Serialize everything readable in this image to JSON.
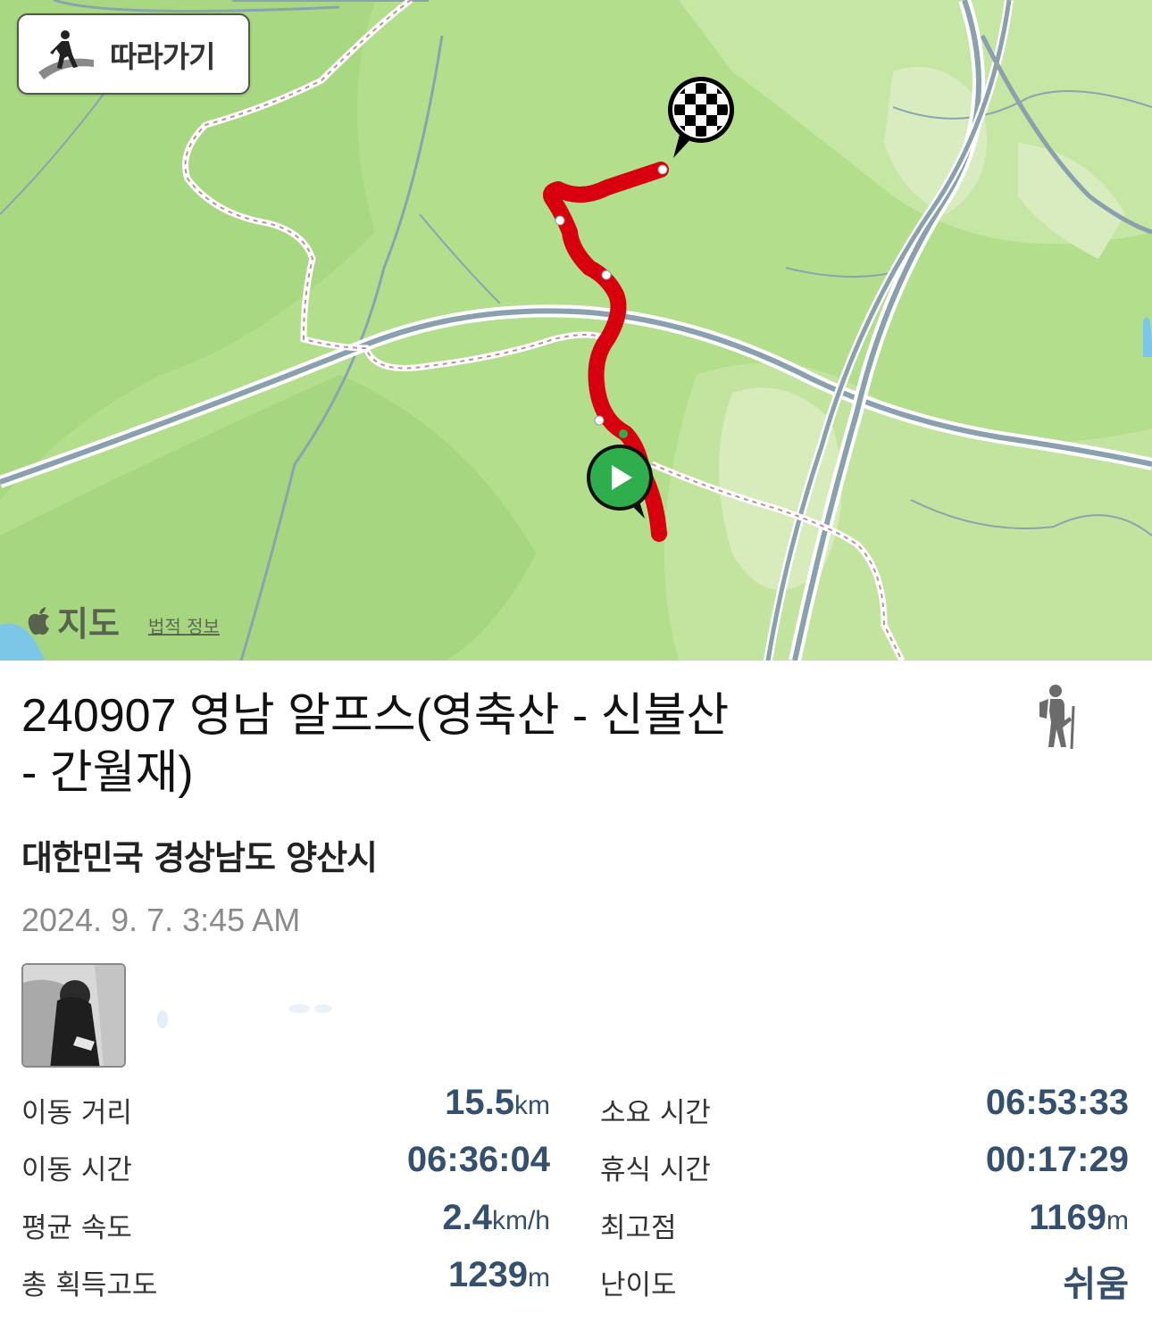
{
  "map": {
    "follow_button_label": "따라가기",
    "attribution_brand": "지도",
    "legal_link": "법적 정보",
    "colors": {
      "land": "#b6e08f",
      "route": "#d8000e",
      "start_marker": "#2fae4e"
    }
  },
  "activity": {
    "title_line1": "240907 영남 알프스(영축산 - 신불산",
    "title_line2": "- 간월재)",
    "location": "대한민국 경상남도 양산시",
    "datetime": "2024. 9. 7. 3:45 AM",
    "type_icon": "hiker-icon"
  },
  "stats": {
    "distance": {
      "label": "이동 거리",
      "value": "15.5",
      "unit": "km"
    },
    "total_time": {
      "label": "소요 시간",
      "value": "06:53:33",
      "unit": ""
    },
    "moving_time": {
      "label": "이동 시간",
      "value": "06:36:04",
      "unit": ""
    },
    "rest_time": {
      "label": "휴식 시간",
      "value": "00:17:29",
      "unit": ""
    },
    "avg_speed": {
      "label": "평균 속도",
      "value": "2.4",
      "unit": "km/h"
    },
    "highest_point": {
      "label": "최고점",
      "value": "1169",
      "unit": "m"
    },
    "elevation_gain": {
      "label": "총 획득고도",
      "value": "1239",
      "unit": "m"
    },
    "difficulty": {
      "label": "난이도",
      "value": "쉬움",
      "unit": ""
    }
  }
}
